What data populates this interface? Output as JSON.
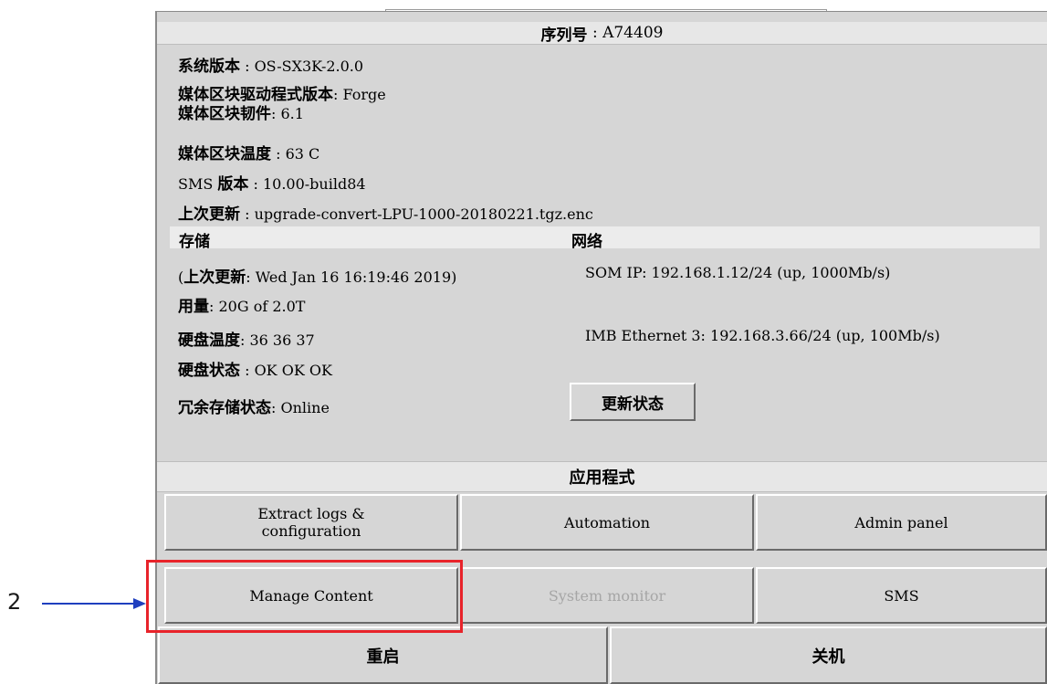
{
  "header": {
    "serial_label": "序列号",
    "serial_value": "A74409"
  },
  "info": [
    {
      "label": "系统版本",
      "sep": " : ",
      "value": "OS-SX3K-2.0.0"
    },
    {
      "label": "媒体区块驱动程式版本",
      "sep": ": ",
      "value": "Forge"
    },
    {
      "label": "媒体区块韧件",
      "sep": ": ",
      "value": "6.1"
    },
    {
      "label": "媒体区块温度",
      "sep": " : ",
      "value": "63 C"
    },
    {
      "prefix": "SMS ",
      "label": "版本",
      "sep": " : ",
      "value": "10.00-build84"
    },
    {
      "label": "上次更新",
      "sep": " : ",
      "value": "upgrade-convert-LPU-1000-20180221.tgz.enc"
    }
  ],
  "storage": {
    "title": "存储",
    "last_update_open": "(",
    "last_update_label": "上次更新",
    "last_update_value": ": Wed Jan 16 16:19:46 2019)",
    "usage_label": "用量",
    "usage_value": ": 20G of 2.0T",
    "disk_temp_label": "硬盘温度",
    "disk_temp_value": ": 36 36 37",
    "disk_status_label": "硬盘状态",
    "disk_status_value": " : OK OK OK",
    "redundancy_label": "冗余存储状态",
    "redundancy_value": ": Online"
  },
  "network": {
    "title": "网络",
    "som_ip": "SOM IP: 192.168.1.12/24 (up, 1000Mb/s)",
    "imb_ethernet": "IMB Ethernet 3: 192.168.3.66/24 (up, 100Mb/s)"
  },
  "refresh_button": "更新状态",
  "apps": {
    "title": "应用程式",
    "extract_line1": "Extract logs &",
    "extract_line2": "configuration",
    "automation": "Automation",
    "admin_panel": "Admin panel",
    "manage_content": "Manage Content",
    "system_monitor": "System monitor",
    "sms": "SMS"
  },
  "bottom": {
    "restart": "重启",
    "shutdown": "关机"
  },
  "callout": {
    "number": "2"
  },
  "colors": {
    "highlight": "#e8232a",
    "arrow": "#1f3fbf",
    "panel": "#d6d6d6"
  }
}
